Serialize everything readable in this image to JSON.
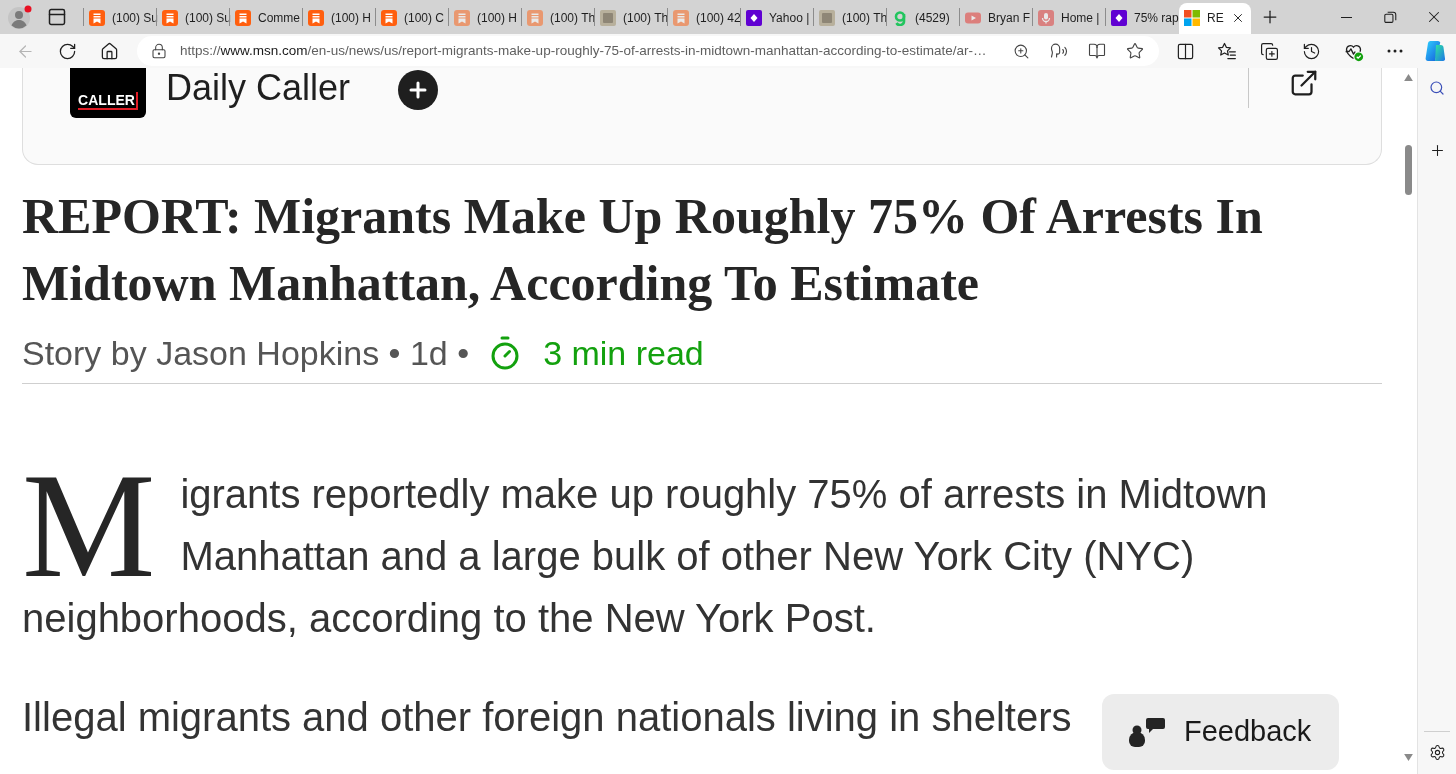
{
  "tabs": [
    {
      "title": "(100) Su",
      "kind": "bookmark",
      "sleeping": false,
      "selected": false
    },
    {
      "title": "(100) Su",
      "kind": "bookmark",
      "sleeping": false,
      "selected": false
    },
    {
      "title": "Comme",
      "kind": "bookmark",
      "sleeping": false,
      "selected": false
    },
    {
      "title": "(100) H",
      "kind": "bookmark",
      "sleeping": false,
      "selected": false
    },
    {
      "title": "(100) C",
      "kind": "bookmark",
      "sleeping": false,
      "selected": false
    },
    {
      "title": "(100) H",
      "kind": "bookmark",
      "sleeping": true,
      "selected": false
    },
    {
      "title": "(100) Th",
      "kind": "bookmark",
      "sleeping": true,
      "selected": false
    },
    {
      "title": "(100) Th",
      "kind": "photo",
      "sleeping": false,
      "selected": false
    },
    {
      "title": "(100) 42",
      "kind": "bookmark",
      "sleeping": true,
      "selected": false
    },
    {
      "title": "Yahoo |",
      "kind": "tile",
      "sleeping": false,
      "selected": false
    },
    {
      "title": "(100) Th",
      "kind": "photo",
      "sleeping": false,
      "selected": false
    },
    {
      "title": "(4529)",
      "kind": "ring",
      "sleeping": false,
      "selected": false
    },
    {
      "title": "Bryan F",
      "kind": "play",
      "sleeping": true,
      "selected": false
    },
    {
      "title": "Home |",
      "kind": "mic",
      "sleeping": true,
      "selected": false
    },
    {
      "title": "75% rap",
      "kind": "tile",
      "sleeping": false,
      "selected": false
    },
    {
      "title": "RE",
      "kind": "squares",
      "sleeping": false,
      "selected": true
    }
  ],
  "toolbar": {
    "back_disabled": true,
    "url": {
      "scheme": "https://",
      "host": "www.msn.com",
      "path": "/en-us/news/us/report-migrants-make-up-roughly-75-of-arrests-in-midtown-manhattan-according-to-estimate/ar-…"
    }
  },
  "article": {
    "source": {
      "logo_text": "CALLER",
      "name": "Daily Caller"
    },
    "headline": "REPORT: Migrants Make Up Roughly 75% Of Arrests In Midtown Manhattan, According To Estimate",
    "byline": "Story by Jason Hopkins • 1d •",
    "read_time": "3 min read",
    "paragraphs": [
      {
        "kind": "drop_cap",
        "initial": "M",
        "text": "igrants reportedly make up roughly 75% of arrests in Midtown Manhattan and a large bulk of other New York City (NYC) neighborhoods, according to the New York Post."
      },
      {
        "kind": "plain",
        "text": "Illegal migrants and other foreign nationals living in shelters"
      }
    ]
  },
  "feedback": {
    "label": "Feedback"
  }
}
